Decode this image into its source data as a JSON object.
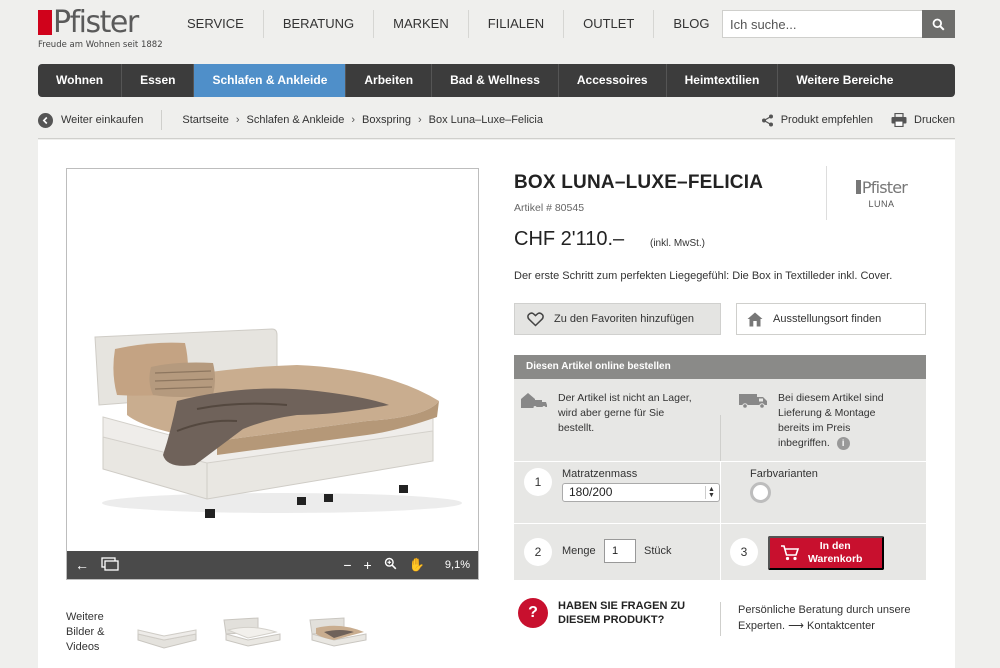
{
  "brand": {
    "name": "Pfister",
    "tagline": "Freude am Wohnen seit 1882"
  },
  "topnav": [
    "SERVICE",
    "BERATUNG",
    "MARKEN",
    "FILIALEN",
    "OUTLET",
    "BLOG"
  ],
  "search": {
    "placeholder": "Ich suche..."
  },
  "mainnav": [
    "Wohnen",
    "Essen",
    "Schlafen & Ankleide",
    "Arbeiten",
    "Bad & Wellness",
    "Accessoires",
    "Heimtextilien",
    "Weitere Bereiche"
  ],
  "mainnav_active": "Schlafen & Ankleide",
  "breadcrumb": {
    "back": "Weiter einkaufen",
    "items": [
      "Startseite",
      "Schlafen & Ankleide",
      "Boxspring",
      "Box Luna–Luxe–Felicia"
    ],
    "recommend": "Produkt empfehlen",
    "print": "Drucken"
  },
  "viewer": {
    "zoom": "9,1%"
  },
  "thumbs_label": "Weitere Bilder & Videos",
  "product": {
    "title": "BOX LUNA–LUXE–FELICIA",
    "article": "Artikel # 80545",
    "brand_logo": "Pfister",
    "brand_line": "LUNA",
    "price": "CHF 2'110.–",
    "price_note": "(inkl. MwSt.)",
    "description": "Der erste Schritt zum perfekten Liegegefühl: Die Box in Textilleder inkl. Cover."
  },
  "actions": {
    "favorites": "Zu den Favoriten hinzufügen",
    "store": "Ausstellungsort finden"
  },
  "order": {
    "header": "Diesen Artikel online bestellen",
    "stock_info": "Der Artikel ist nicht an Lager, wird aber gerne für Sie bestellt.",
    "delivery_info": "Bei diesem Artikel sind Lieferung & Montage bereits im Preis inbegriffen.",
    "step1": "1",
    "mattress_label": "Matratzenmass",
    "mattress_value": "180/200",
    "color_label": "Farbvarianten",
    "step2": "2",
    "qty_label": "Menge",
    "qty_value": "1",
    "qty_unit": "Stück",
    "step3": "3",
    "cart_line1": "In den",
    "cart_line2": "Warenkorb"
  },
  "faq": {
    "icon": "?",
    "line1": "HABEN SIE FRAGEN ZU",
    "line2": "DIESEM PRODUKT?",
    "contact_text": "Persönliche Beratung durch unsere",
    "contact_line2a": "Experten.",
    "contact_arrow": "⟶",
    "contact_link": "Kontaktcenter"
  },
  "colors": {
    "accent": "#c8102e",
    "nav_active": "#4f8fc9",
    "nav_bg": "#3c3c3c"
  }
}
